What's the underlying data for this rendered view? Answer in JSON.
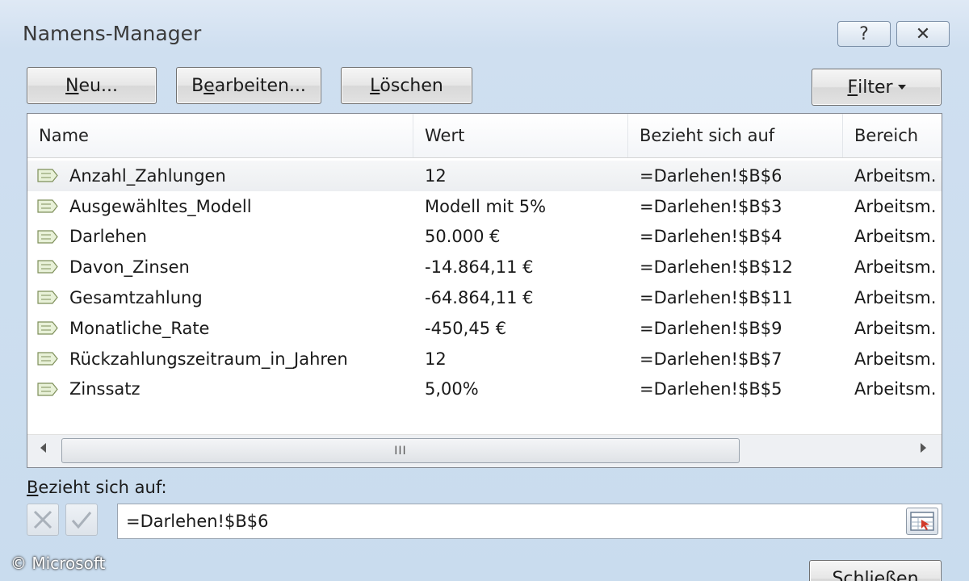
{
  "window": {
    "title": "Namens-Manager",
    "help_label": "?",
    "close_label": "✕"
  },
  "toolbar": {
    "new_pre": "",
    "new_u": "N",
    "new_post": "eu...",
    "edit_pre": "B",
    "edit_u": "e",
    "edit_post": "arbeiten...",
    "delete_pre": "",
    "delete_u": "L",
    "delete_post": "öschen",
    "filter_pre": "",
    "filter_u": "F",
    "filter_post": "ilter"
  },
  "table": {
    "columns": {
      "name": "Name",
      "value": "Wert",
      "refers_to": "Bezieht sich auf",
      "scope": "Bereich"
    },
    "rows": [
      {
        "name": "Anzahl_Zahlungen",
        "value": "12",
        "refers_to": "=Darlehen!$B$6",
        "scope": "Arbeitsm."
      },
      {
        "name": "Ausgewähltes_Modell",
        "value": "Modell mit 5%",
        "refers_to": "=Darlehen!$B$3",
        "scope": "Arbeitsm."
      },
      {
        "name": "Darlehen",
        "value": "50.000 €",
        "refers_to": "=Darlehen!$B$4",
        "scope": "Arbeitsm."
      },
      {
        "name": "Davon_Zinsen",
        "value": "-14.864,11 €",
        "refers_to": "=Darlehen!$B$12",
        "scope": "Arbeitsm."
      },
      {
        "name": "Gesamtzahlung",
        "value": "-64.864,11 €",
        "refers_to": "=Darlehen!$B$11",
        "scope": "Arbeitsm."
      },
      {
        "name": "Monatliche_Rate",
        "value": "-450,45 €",
        "refers_to": "=Darlehen!$B$9",
        "scope": "Arbeitsm."
      },
      {
        "name": "Rückzahlungszeitraum_in_Jahren",
        "value": "12",
        "refers_to": "=Darlehen!$B$7",
        "scope": "Arbeitsm."
      },
      {
        "name": "Zinssatz",
        "value": "5,00%",
        "refers_to": "=Darlehen!$B$5",
        "scope": "Arbeitsm."
      }
    ],
    "scroll_grip": "III"
  },
  "refers_to": {
    "label_u": "B",
    "label_post": "ezieht sich auf:",
    "value": "=Darlehen!$B$6"
  },
  "footer": {
    "close_label": "Schließen"
  },
  "watermark": "© Microsoft",
  "colors": {
    "accent": "#c9dcee",
    "icon": "#7fb3c9"
  }
}
